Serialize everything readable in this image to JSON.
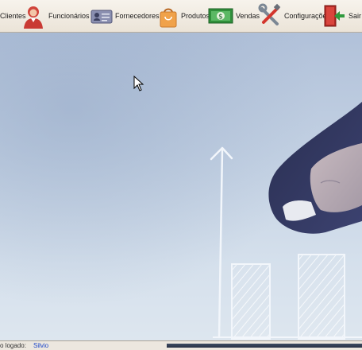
{
  "toolbar": {
    "items": [
      {
        "label": "Clientes",
        "icon": "clients-icon"
      },
      {
        "label": "Funcionários",
        "icon": "employee-icon"
      },
      {
        "label": "Fornecedores",
        "icon": "supplier-card-icon"
      },
      {
        "label": "Produtos",
        "icon": "shopping-bag-icon"
      },
      {
        "label": "Vendas",
        "icon": "money-icon"
      },
      {
        "label": "Configurações",
        "icon": "tools-icon"
      },
      {
        "label": "Sair",
        "icon": "exit-door-icon"
      }
    ]
  },
  "status": {
    "label": "o logado:",
    "user": "Silvio"
  },
  "colors": {
    "toolbar_bg": "#efe9df",
    "desktop_bg": "#c9d6e5",
    "status_user": "#1d47c9"
  }
}
